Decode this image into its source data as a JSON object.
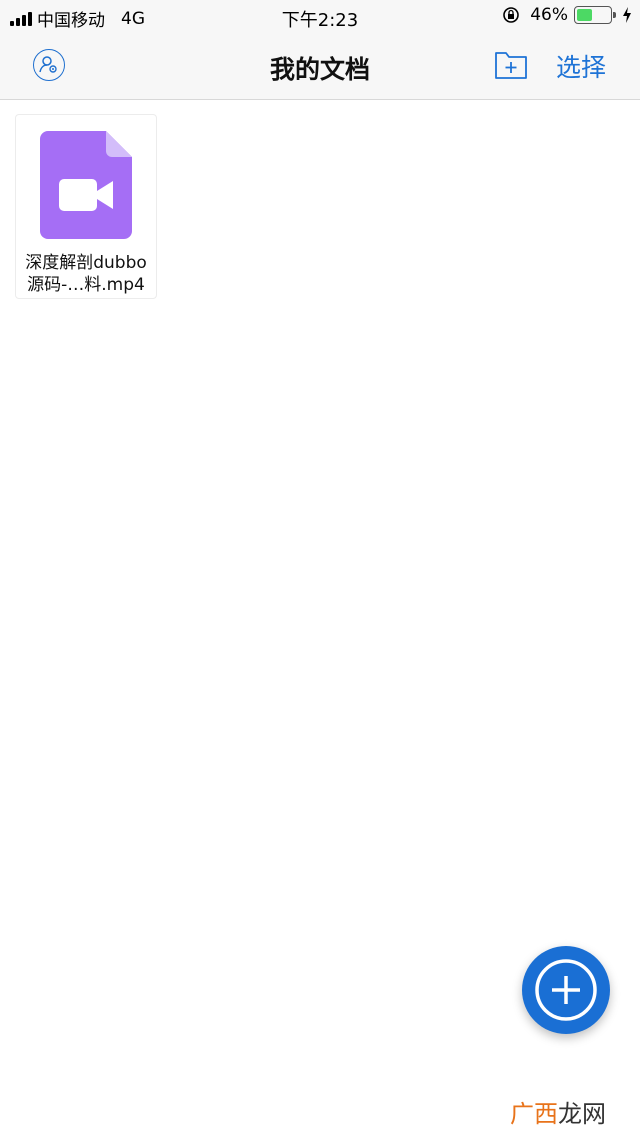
{
  "status_bar": {
    "carrier": "中国移动",
    "network": "4G",
    "time": "下午2:23",
    "battery_percent": "46%",
    "battery_level": 0.46,
    "icons": [
      "signal-icon",
      "orientation-lock-icon",
      "battery-icon",
      "charging-bolt-icon"
    ]
  },
  "nav": {
    "title": "我的文档",
    "select_label": "选择",
    "icons": [
      "user-settings-icon",
      "new-folder-icon"
    ]
  },
  "files": [
    {
      "name_line1": "深度解剖dubbo",
      "name_line2": "源码-…料.mp4",
      "icon": "video-file-icon",
      "icon_color": "#a56ef5"
    }
  ],
  "fab": {
    "icon": "plus-icon",
    "color": "#1a6fd4"
  },
  "watermark": {
    "accent_text": "广西",
    "text": "龙网"
  },
  "colors": {
    "accent": "#1e73d6",
    "background": "#ffffff",
    "bar": "#f7f7f7"
  }
}
